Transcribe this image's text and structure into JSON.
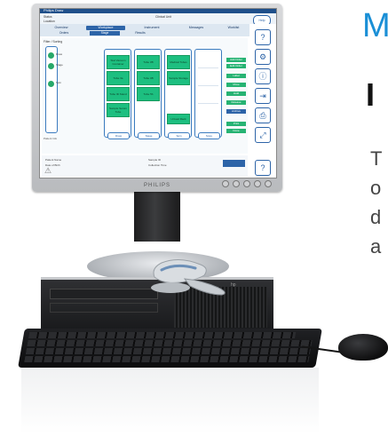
{
  "side_text": {
    "letter_m": "M",
    "letter_i": "I",
    "line1": "T",
    "line2": "o",
    "line3": "d",
    "line4": "a"
  },
  "monitor": {
    "brand": "PHILIPS",
    "app": {
      "title": "Philips Draw",
      "header": {
        "field1_label": "Status",
        "field2_label": "Location",
        "field3_label": "Clinical Unit"
      },
      "help_label": "Help",
      "nav_tabs": [
        {
          "label": "Overview",
          "active": false
        },
        {
          "label": "Workplace",
          "active": true
        },
        {
          "label": "Instrument",
          "active": false
        },
        {
          "label": "Messages",
          "active": false
        },
        {
          "label": "Worklist",
          "active": false
        }
      ],
      "sub_tabs": [
        {
          "label": "Orders",
          "active": false
        },
        {
          "label": "Stage",
          "active": true
        },
        {
          "label": "Results",
          "active": false
        }
      ],
      "content": {
        "filter_label": "Filter / Sorting",
        "rail_items": [
          "Draw",
          "Stage",
          "Spin"
        ],
        "rail_bottom": "Patient Info",
        "columns": [
          {
            "cards": [
              "Stat Vacuum Container",
              "Tube 3a",
              "Tube ID Stand",
              "Sample Serum Tube"
            ],
            "footer": "Draw"
          },
          {
            "cards": [
              "Tube 3B",
              "Tube 4B",
              "Tube 5b"
            ],
            "footer": "Stage"
          },
          {
            "cards": [
              "Medical Tubes",
              "Sample Storage",
              "Unload Rack"
            ],
            "footer": "Spin"
          },
          {
            "cards": [],
            "footer": "Store"
          }
        ],
        "right_list": [
          "Add Order",
          "Edit Order",
          "Label",
          "Move",
          "Hold",
          "Release",
          "Archive",
          "Print",
          "Done"
        ]
      },
      "lower": {
        "left_label_1": "Patient Name",
        "left_label_2": "Date of Birth",
        "right_label_1": "Sample ID",
        "right_label_2": "Collection Time"
      }
    }
  },
  "pc": {
    "logo": "hp"
  },
  "icons": {
    "warning": "warning-icon",
    "tools": [
      "help-icon",
      "settings-icon",
      "info-icon",
      "export-icon",
      "print-icon",
      "expand-icon",
      "help-circle-icon"
    ]
  },
  "colors": {
    "accent_blue": "#2d64a8",
    "card_green": "#1dbf80",
    "brand_blue": "#1a8fd6"
  }
}
